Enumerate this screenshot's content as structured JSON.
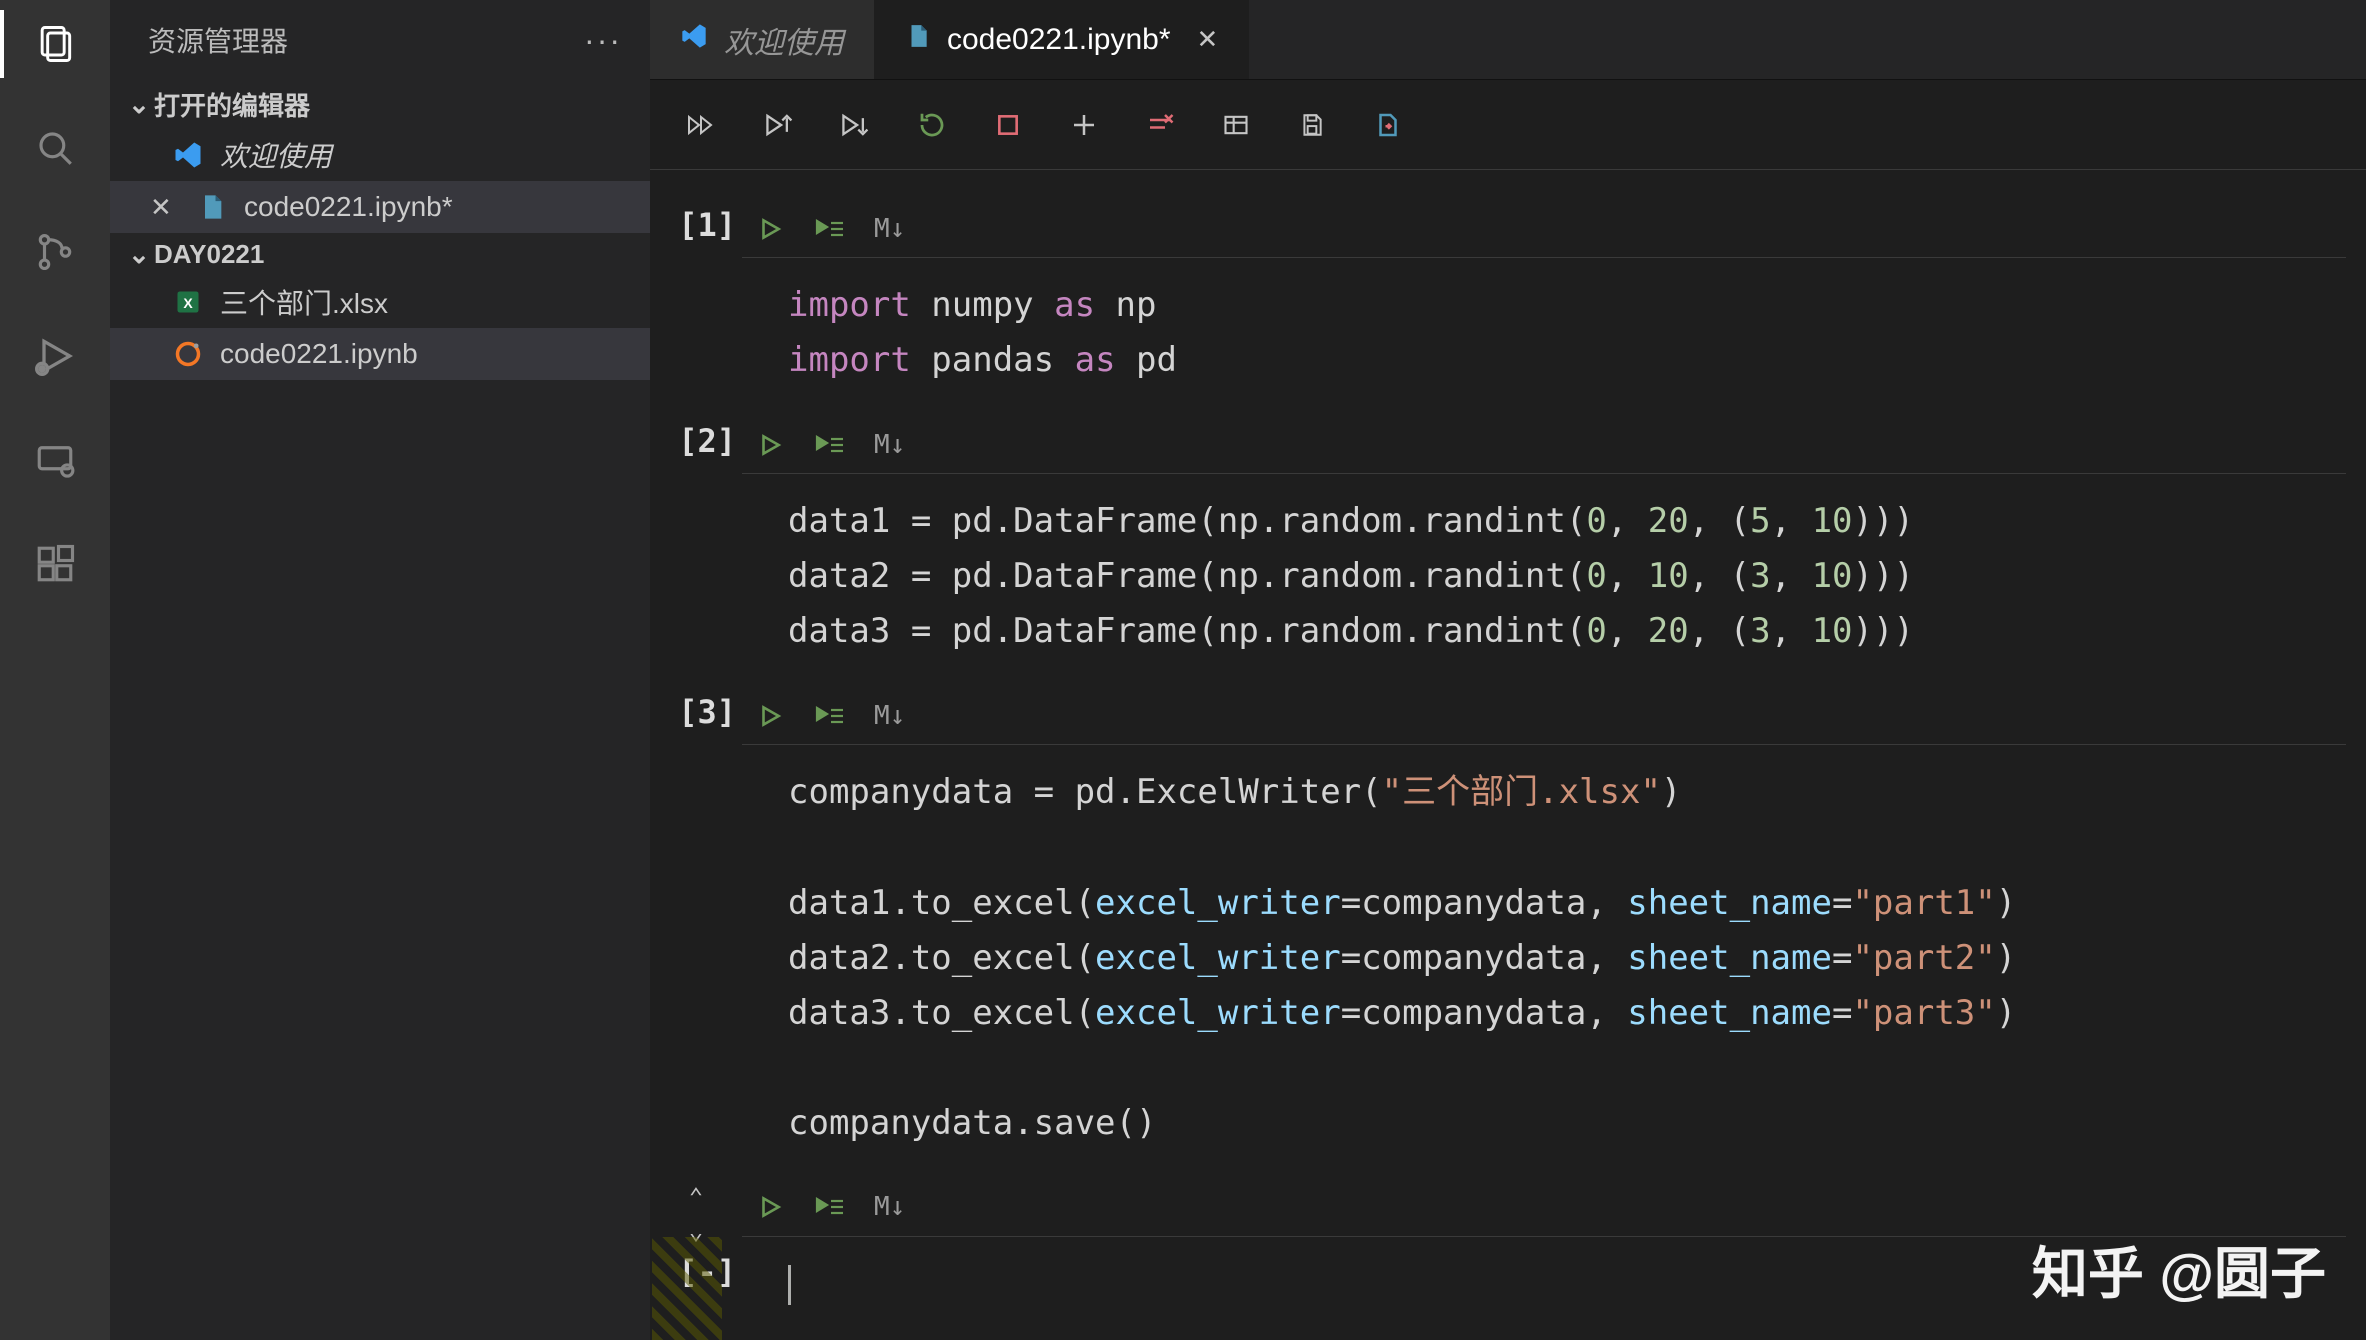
{
  "sidebar": {
    "title": "资源管理器",
    "open_editors_label": "打开的编辑器",
    "folder_label": "DAY0221",
    "editors": [
      {
        "label": "欢迎使用",
        "italic": true,
        "closeable": false
      },
      {
        "label": "code0221.ipynb*",
        "italic": false,
        "closeable": true
      }
    ],
    "files": [
      {
        "label": "三个部门.xlsx"
      },
      {
        "label": "code0221.ipynb"
      }
    ]
  },
  "tabs": [
    {
      "label": "欢迎使用",
      "active": false
    },
    {
      "label": "code0221.ipynb*",
      "active": true
    }
  ],
  "cell_toolbar": {
    "md_label": "M↓"
  },
  "cells": [
    {
      "exec": "[1]",
      "code": [
        {
          "t": "import",
          "c": "k"
        },
        {
          "t": " numpy ",
          "c": ""
        },
        {
          "t": "as",
          "c": "k"
        },
        {
          "t": " np\n",
          "c": ""
        },
        {
          "t": "import",
          "c": "k"
        },
        {
          "t": " pandas ",
          "c": ""
        },
        {
          "t": "as",
          "c": "k"
        },
        {
          "t": " pd",
          "c": ""
        }
      ]
    },
    {
      "exec": "[2]",
      "code": [
        {
          "t": "data1 = pd.DataFrame(np.random.randint(",
          "c": ""
        },
        {
          "t": "0",
          "c": "n"
        },
        {
          "t": ", ",
          "c": ""
        },
        {
          "t": "20",
          "c": "n"
        },
        {
          "t": ", (",
          "c": ""
        },
        {
          "t": "5",
          "c": "n"
        },
        {
          "t": ", ",
          "c": ""
        },
        {
          "t": "10",
          "c": "n"
        },
        {
          "t": ")))\n",
          "c": ""
        },
        {
          "t": "data2 = pd.DataFrame(np.random.randint(",
          "c": ""
        },
        {
          "t": "0",
          "c": "n"
        },
        {
          "t": ", ",
          "c": ""
        },
        {
          "t": "10",
          "c": "n"
        },
        {
          "t": ", (",
          "c": ""
        },
        {
          "t": "3",
          "c": "n"
        },
        {
          "t": ", ",
          "c": ""
        },
        {
          "t": "10",
          "c": "n"
        },
        {
          "t": ")))\n",
          "c": ""
        },
        {
          "t": "data3 = pd.DataFrame(np.random.randint(",
          "c": ""
        },
        {
          "t": "0",
          "c": "n"
        },
        {
          "t": ", ",
          "c": ""
        },
        {
          "t": "20",
          "c": "n"
        },
        {
          "t": ", (",
          "c": ""
        },
        {
          "t": "3",
          "c": "n"
        },
        {
          "t": ", ",
          "c": ""
        },
        {
          "t": "10",
          "c": "n"
        },
        {
          "t": ")))",
          "c": ""
        }
      ]
    },
    {
      "exec": "[3]",
      "code": [
        {
          "t": "companydata = pd.ExcelWriter(",
          "c": ""
        },
        {
          "t": "\"三个部门.xlsx\"",
          "c": "s"
        },
        {
          "t": ")\n\n",
          "c": ""
        },
        {
          "t": "data1.to_excel(",
          "c": ""
        },
        {
          "t": "excel_writer",
          "c": "p"
        },
        {
          "t": "=companydata, ",
          "c": ""
        },
        {
          "t": "sheet_name",
          "c": "p"
        },
        {
          "t": "=",
          "c": ""
        },
        {
          "t": "\"part1\"",
          "c": "s"
        },
        {
          "t": ")\n",
          "c": ""
        },
        {
          "t": "data2.to_excel(",
          "c": ""
        },
        {
          "t": "excel_writer",
          "c": "p"
        },
        {
          "t": "=companydata, ",
          "c": ""
        },
        {
          "t": "sheet_name",
          "c": "p"
        },
        {
          "t": "=",
          "c": ""
        },
        {
          "t": "\"part2\"",
          "c": "s"
        },
        {
          "t": ")\n",
          "c": ""
        },
        {
          "t": "data3.to_excel(",
          "c": ""
        },
        {
          "t": "excel_writer",
          "c": "p"
        },
        {
          "t": "=companydata, ",
          "c": ""
        },
        {
          "t": "sheet_name",
          "c": "p"
        },
        {
          "t": "=",
          "c": ""
        },
        {
          "t": "\"part3\"",
          "c": "s"
        },
        {
          "t": ")\n\n",
          "c": ""
        },
        {
          "t": "companydata.save()",
          "c": ""
        }
      ]
    },
    {
      "exec": "[-]",
      "empty": true,
      "show_arrows": true
    }
  ],
  "watermark": "知乎 @圆子"
}
